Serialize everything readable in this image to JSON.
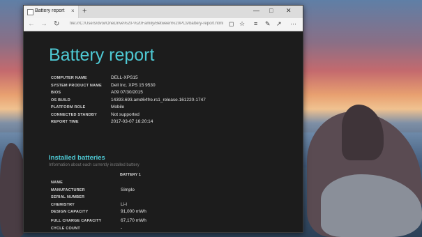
{
  "tab": {
    "title": "Battery report",
    "close": "×"
  },
  "new_tab": "+",
  "window_controls": {
    "minimize": "—",
    "maximize": "□",
    "close": "✕"
  },
  "address": {
    "url": "file:///C:/Users/dvoi/OneDrive%20-%20Family/Between%20PCs/battery-report.html"
  },
  "report": {
    "title": "Battery report",
    "info": [
      {
        "label": "COMPUTER NAME",
        "value": "DELL-XPS15"
      },
      {
        "label": "SYSTEM PRODUCT NAME",
        "value": "Dell Inc. XPS 15 9530"
      },
      {
        "label": "BIOS",
        "value": "A09 07/30/2015"
      },
      {
        "label": "OS BUILD",
        "value": "14393.693.amd64fre.rs1_release.161220-1747"
      },
      {
        "label": "PLATFORM ROLE",
        "value": "Mobile"
      },
      {
        "label": "CONNECTED STANDBY",
        "value": "Not supported"
      },
      {
        "label": "REPORT TIME",
        "value": "2017-03-07   16:20:14"
      }
    ],
    "batteries": {
      "title": "Installed batteries",
      "subtitle": "Information about each currently installed battery",
      "column": "BATTERY 1",
      "rows": [
        {
          "label": "NAME",
          "value": ""
        },
        {
          "label": "MANUFACTURER",
          "value": "Simplo"
        },
        {
          "label": "SERIAL NUMBER",
          "value": ""
        },
        {
          "label": "CHEMISTRY",
          "value": "Li-I"
        },
        {
          "label": "DESIGN CAPACITY",
          "value": "91,000 mWh"
        },
        {
          "label": "FULL CHARGE CAPACITY",
          "value": "67,170 mWh"
        },
        {
          "label": "CYCLE COUNT",
          "value": "-"
        }
      ]
    }
  }
}
